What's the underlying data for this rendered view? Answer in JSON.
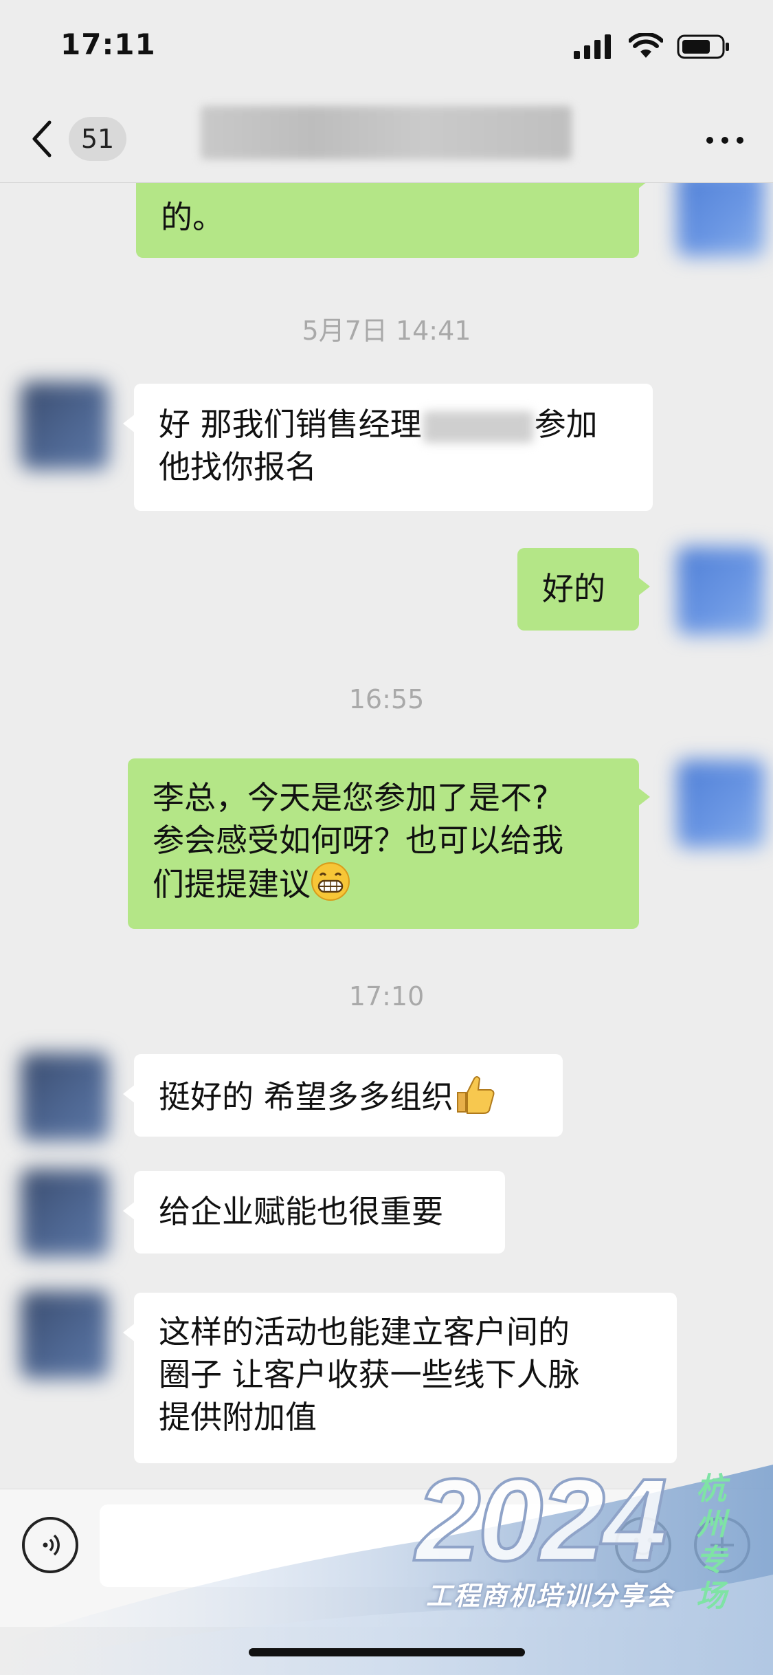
{
  "status_bar": {
    "time": "17:11"
  },
  "nav": {
    "unread_count": "51"
  },
  "messages": [
    {
      "text": "的。"
    },
    {
      "timestamp": "5月7日 14:41"
    },
    {
      "text_before": "好 那我们销售经理",
      "text_after": "参加",
      "line2": "他找你报名"
    },
    {
      "text": "好的"
    },
    {
      "timestamp": "16:55"
    },
    {
      "line1": "李总，今天是您参加了是不?",
      "line2": "参会感受如何呀？也可以给我",
      "line3": "们提提建议"
    },
    {
      "timestamp": "17:10"
    },
    {
      "text": "挺好的 希望多多组织"
    },
    {
      "text": "给企业赋能也很重要"
    },
    {
      "line1": "这样的活动也能建立客户间的",
      "line2": "圈子 让客户收获一些线下人脉",
      "line3": "提供附加值"
    }
  ],
  "watermark": {
    "year": "2024",
    "city": "杭州专场",
    "subtitle": "工程商机培训分享会"
  },
  "icons": [
    "signal-icon",
    "wifi-icon",
    "battery-icon",
    "back-icon",
    "more-icon",
    "grin-emoji-icon",
    "thumbs-up-emoji-icon",
    "voice-icon",
    "emoji-icon",
    "plus-icon"
  ]
}
